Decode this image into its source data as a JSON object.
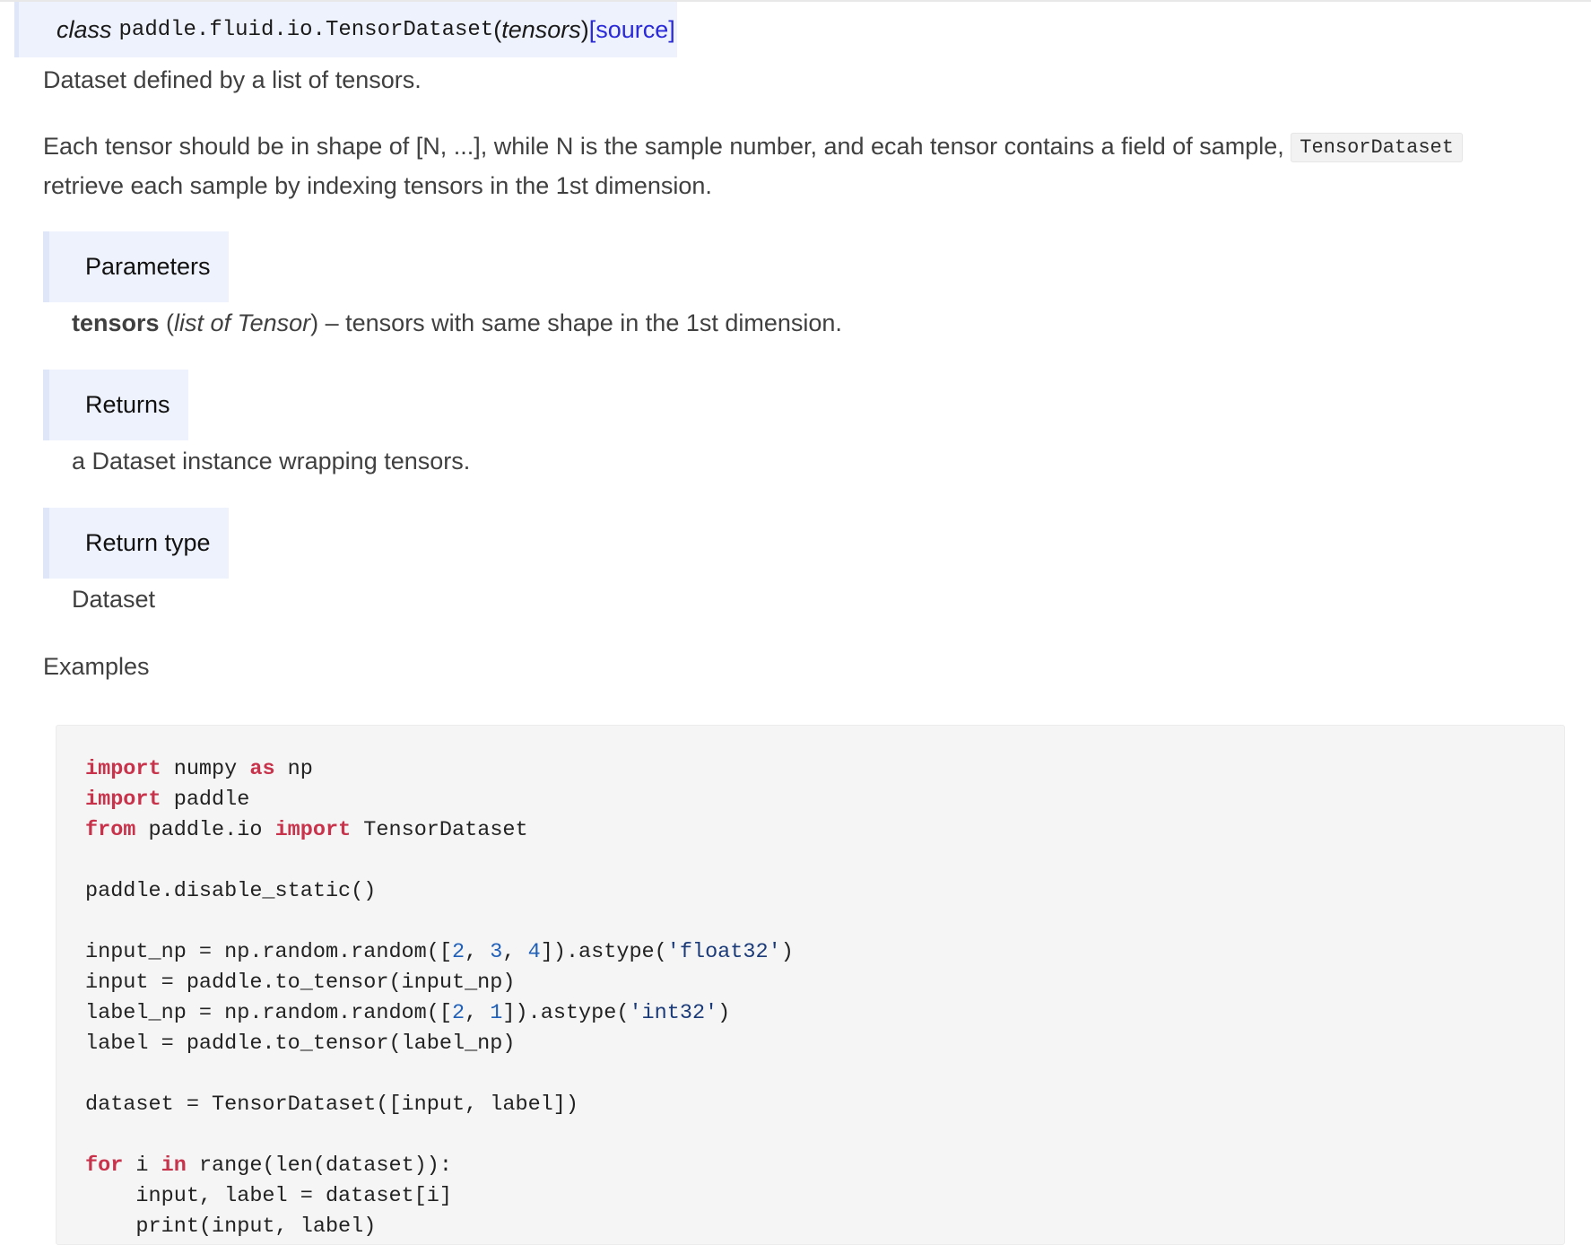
{
  "signature": {
    "keyword": "class",
    "module_path": "paddle.fluid.io.TensorDataset",
    "open_paren": "(",
    "argument": "tensors",
    "close_paren": ")",
    "source_link": "[source]"
  },
  "description": {
    "summary": "Dataset defined by a list of tensors.",
    "detail_line1_prefix": "Each tensor should be in shape of [N, ...], while N is the sample number, and ecah tensor contains a field of sample,",
    "detail_inline_code": "TensorDataset",
    "detail_line2": "retrieve each sample by indexing tensors in the 1st dimension."
  },
  "parameters": {
    "heading": "Parameters",
    "name": "tensors",
    "type_open": " (",
    "type": "list of Tensor",
    "type_close": ")",
    "description": " – tensors with same shape in the 1st dimension."
  },
  "returns": {
    "heading": "Returns",
    "description": "a Dataset instance wrapping tensors."
  },
  "return_type": {
    "heading": "Return type",
    "value": "Dataset"
  },
  "examples": {
    "heading": "Examples",
    "code_lines": [
      [
        {
          "t": "import",
          "c": "k"
        },
        {
          "t": " numpy "
        },
        {
          "t": "as",
          "c": "k"
        },
        {
          "t": " np"
        }
      ],
      [
        {
          "t": "import",
          "c": "k"
        },
        {
          "t": " paddle"
        }
      ],
      [
        {
          "t": "from",
          "c": "k"
        },
        {
          "t": " paddle.io "
        },
        {
          "t": "import",
          "c": "k"
        },
        {
          "t": " TensorDataset"
        }
      ],
      [],
      [
        {
          "t": "paddle.disable_static()"
        }
      ],
      [],
      [
        {
          "t": "input_np = np.random.random(["
        },
        {
          "t": "2",
          "c": "n"
        },
        {
          "t": ", "
        },
        {
          "t": "3",
          "c": "n"
        },
        {
          "t": ", "
        },
        {
          "t": "4",
          "c": "n"
        },
        {
          "t": "]).astype("
        },
        {
          "t": "'float32'",
          "c": "s"
        },
        {
          "t": ")"
        }
      ],
      [
        {
          "t": "input = paddle.to_tensor(input_np)"
        }
      ],
      [
        {
          "t": "label_np = np.random.random(["
        },
        {
          "t": "2",
          "c": "n"
        },
        {
          "t": ", "
        },
        {
          "t": "1",
          "c": "n"
        },
        {
          "t": "]).astype("
        },
        {
          "t": "'int32'",
          "c": "s"
        },
        {
          "t": ")"
        }
      ],
      [
        {
          "t": "label = paddle.to_tensor(label_np)"
        }
      ],
      [],
      [
        {
          "t": "dataset = TensorDataset([input, label])"
        }
      ],
      [],
      [
        {
          "t": "for",
          "c": "k"
        },
        {
          "t": " i "
        },
        {
          "t": "in",
          "c": "k"
        },
        {
          "t": " range(len(dataset)):"
        }
      ],
      [
        {
          "t": "    input, label = dataset[i]"
        }
      ],
      [
        {
          "t": "    print(input, label)"
        }
      ]
    ]
  }
}
